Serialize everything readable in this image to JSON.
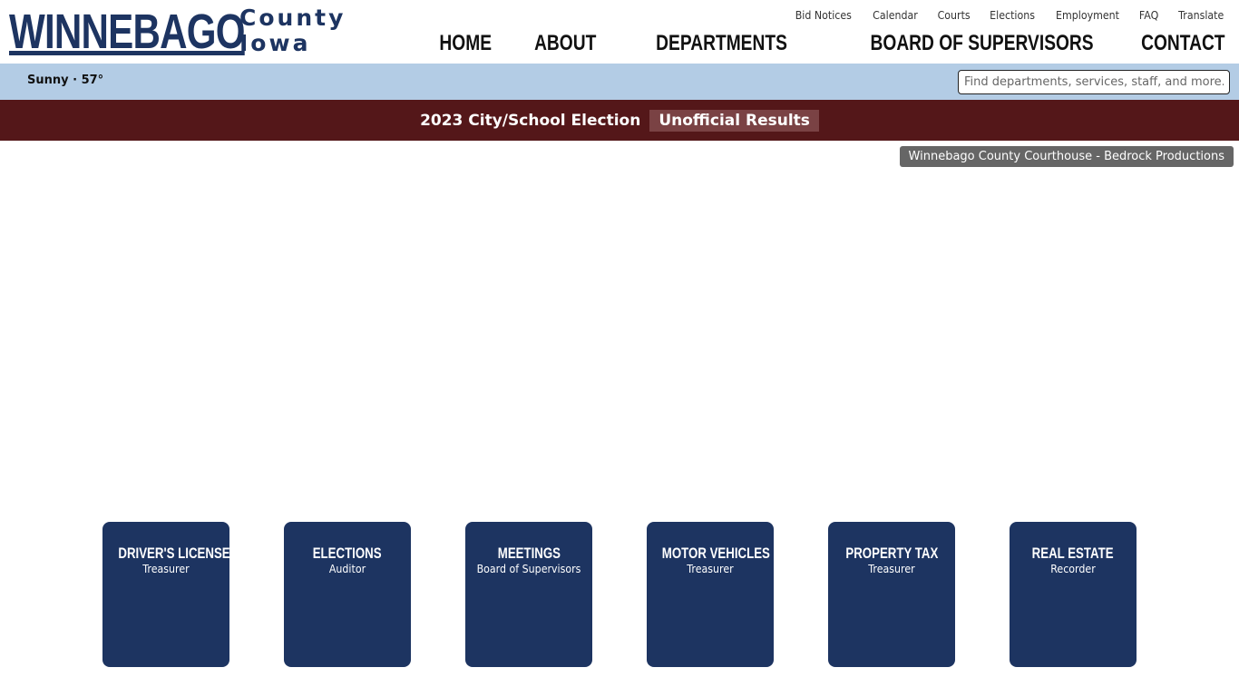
{
  "header": {
    "logo_main": "WINNEBAGO",
    "logo_sub_line1": "County",
    "logo_sub_line2": "Iowa",
    "utility_links": [
      "Bid Notices",
      "Calendar",
      "Courts",
      "Elections",
      "Employment",
      "FAQ",
      "Translate"
    ],
    "main_nav": [
      "HOME",
      "ABOUT",
      "DEPARTMENTS",
      "BOARD OF SUPERVISORS",
      "CONTACT"
    ]
  },
  "weather_bar": {
    "weather": "Sunny · 57°",
    "search_placeholder": "Find departments, services, staff, and more..."
  },
  "alert_bar": {
    "text": "2023 City/School Election",
    "link": "Unofficial Results"
  },
  "hero": {
    "caption": "Winnebago County Courthouse - Bedrock Productions"
  },
  "tiles": [
    {
      "title": "DRIVER'S LICENSE",
      "subtitle": "Treasurer"
    },
    {
      "title": "ELECTIONS",
      "subtitle": "Auditor"
    },
    {
      "title": "MEETINGS",
      "subtitle": "Board of Supervisors"
    },
    {
      "title": "MOTOR VEHICLES",
      "subtitle": "Treasurer"
    },
    {
      "title": "PROPERTY TAX",
      "subtitle": "Treasurer"
    },
    {
      "title": "REAL ESTATE",
      "subtitle": "Recorder"
    }
  ],
  "colors": {
    "brand_navy": "#1d3461",
    "weather_bar": "#b3cce5",
    "alert_bar": "#541719",
    "alert_highlight": "#7a4244",
    "caption_bg": "#666666"
  }
}
